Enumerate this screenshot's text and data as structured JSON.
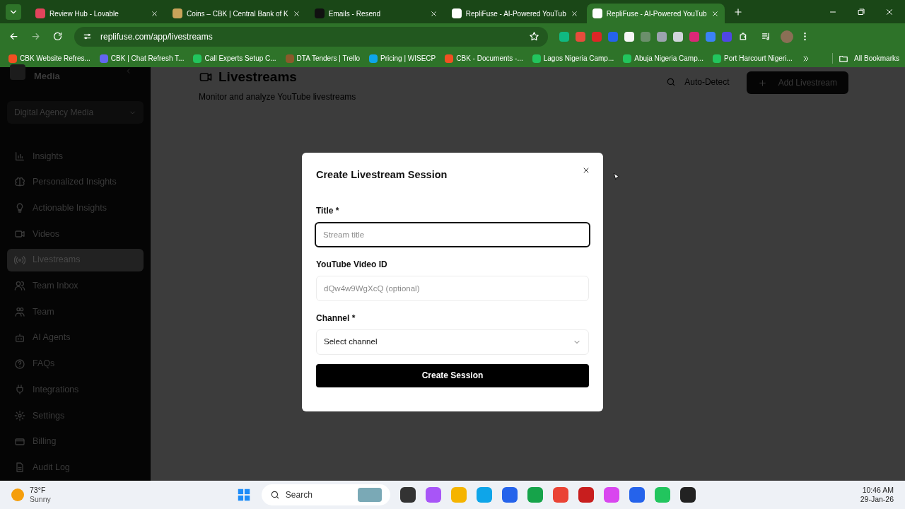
{
  "browser": {
    "tabs": [
      {
        "title": "Review Hub - Lovable",
        "selected": false
      },
      {
        "title": "Coins – CBK | Central Bank of K",
        "selected": false
      },
      {
        "title": "Emails - Resend",
        "selected": false
      },
      {
        "title": "RepliFuse - AI-Powered YouTub",
        "selected": false
      },
      {
        "title": "RepliFuse - AI-Powered YouTub",
        "selected": true
      }
    ],
    "address": "replifuse.com/app/livestreams",
    "bookmarks": [
      "CBK Website Refres...",
      "CBK | Chat Refresh T...",
      "Call Experts Setup C...",
      "DTA Tenders | Trello",
      "Pricing | WISECP",
      "CBK - Documents -...",
      "Lagos Nigeria Camp...",
      "Abuja Nigeria Camp...",
      "Port Harcourt Nigeri..."
    ],
    "all_bookmarks": "All Bookmarks"
  },
  "sidebar": {
    "brand": "Media",
    "workspace": "Digital Agency Media",
    "items": [
      {
        "label": "Insights",
        "selected": false
      },
      {
        "label": "Personalized Insights",
        "selected": false
      },
      {
        "label": "Actionable Insights",
        "selected": false
      },
      {
        "label": "Videos",
        "selected": false
      },
      {
        "label": "Livestreams",
        "selected": true
      },
      {
        "label": "Team Inbox",
        "selected": false
      },
      {
        "label": "Team",
        "selected": false
      },
      {
        "label": "AI Agents",
        "selected": false
      },
      {
        "label": "FAQs",
        "selected": false
      },
      {
        "label": "Integrations",
        "selected": false
      },
      {
        "label": "Settings",
        "selected": false
      },
      {
        "label": "Billing",
        "selected": false
      },
      {
        "label": "Audit Log",
        "selected": false
      }
    ]
  },
  "header": {
    "title": "Livestreams",
    "subtitle": "Monitor and analyze YouTube livestreams",
    "auto_detect": "Auto-Detect",
    "add_button": "Add Livestream"
  },
  "dialog": {
    "title": "Create Livestream Session",
    "fields": [
      {
        "kind": "text",
        "label": "Title *",
        "placeholder": "Stream title",
        "focused": true
      },
      {
        "kind": "text",
        "label": "YouTube Video ID",
        "placeholder": "dQw4w9WgXcQ (optional)",
        "focused": false
      },
      {
        "kind": "select",
        "label": "Channel *",
        "value": "Select channel"
      }
    ],
    "submit": "Create Session"
  },
  "taskbar": {
    "temperature": "73°F",
    "weather": "Sunny",
    "search": "Search",
    "time": "10:46 AM",
    "date": "29-Jan-26"
  }
}
